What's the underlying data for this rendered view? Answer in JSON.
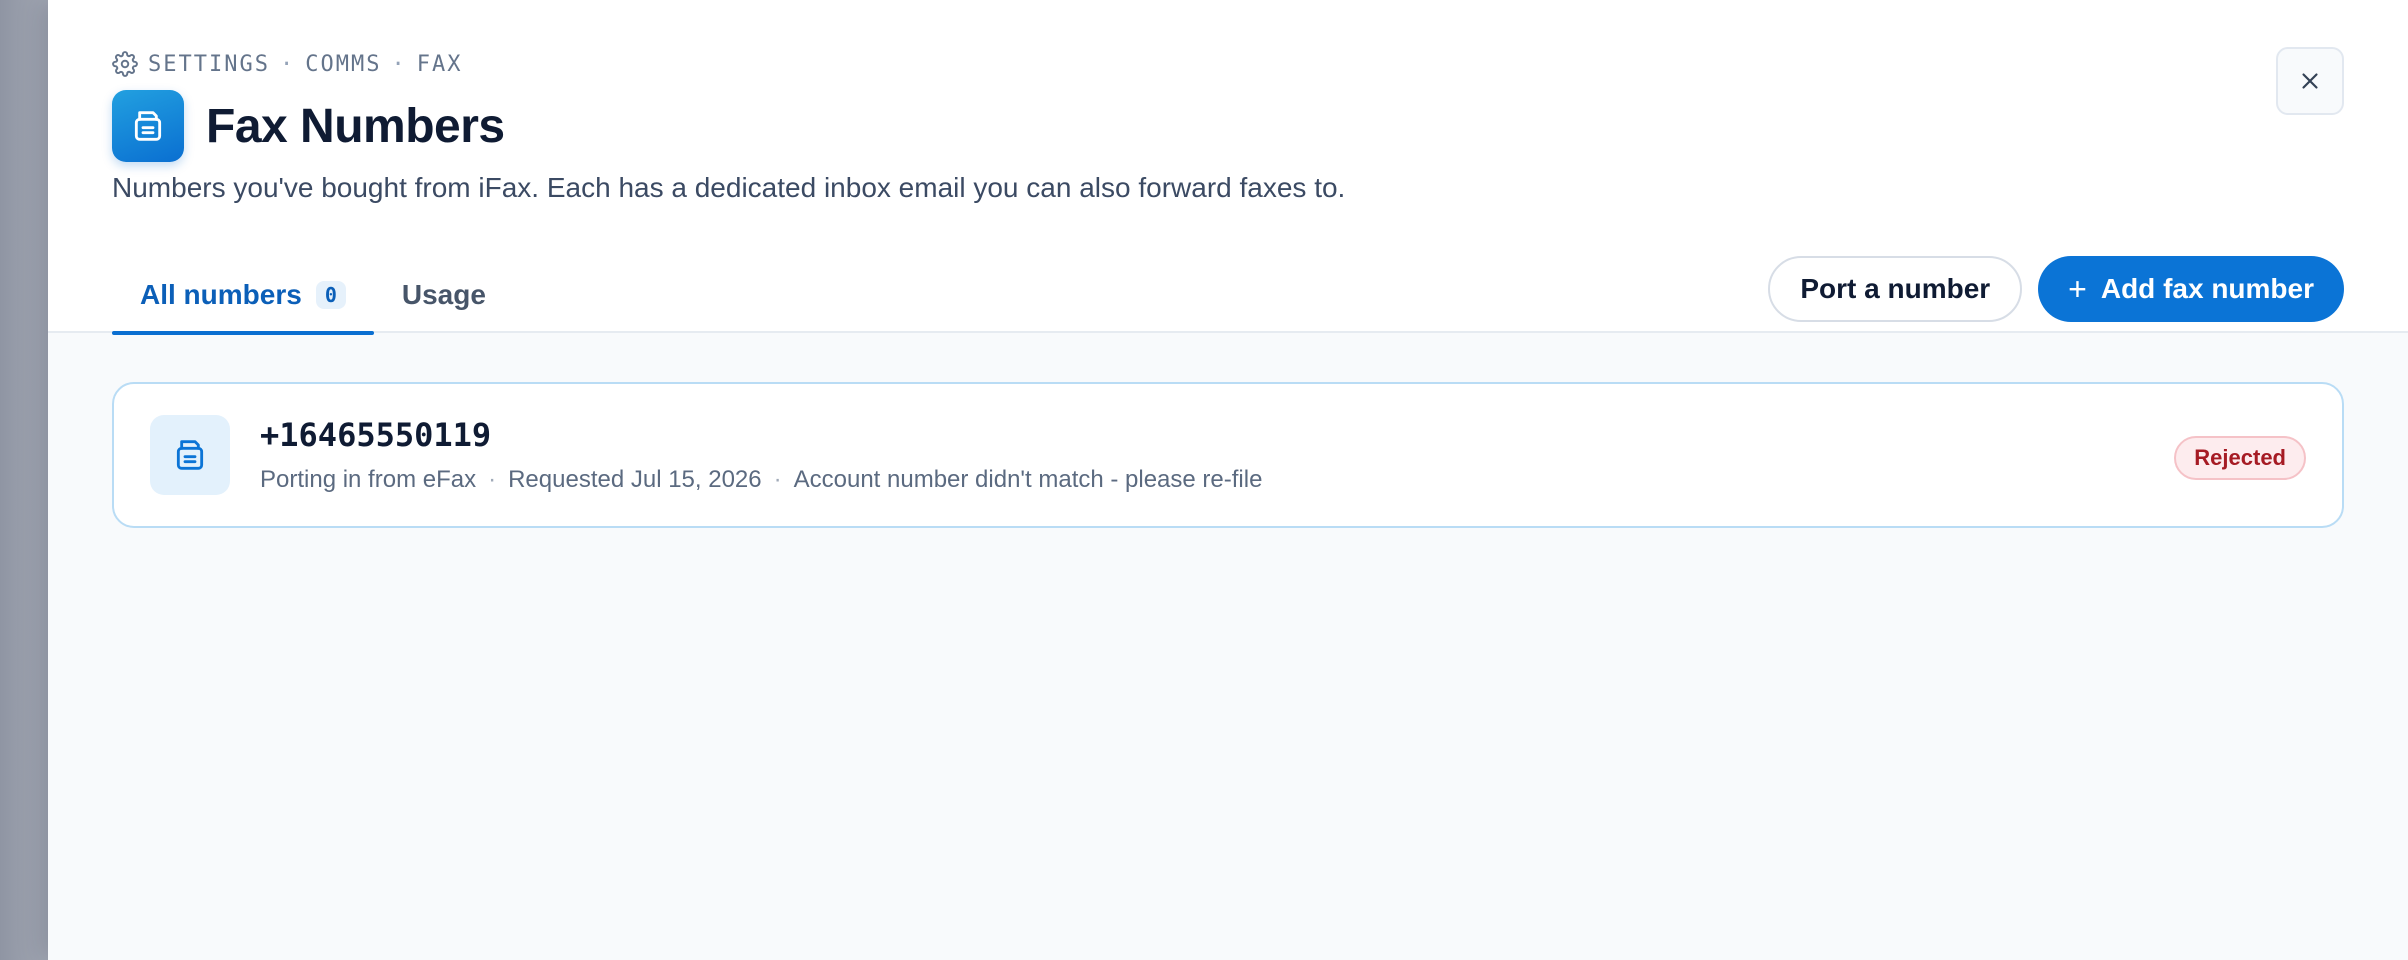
{
  "breadcrumb": {
    "items": [
      "SETTINGS",
      "COMMS",
      "FAX"
    ],
    "separator": "·"
  },
  "page": {
    "title": "Fax Numbers",
    "subtitle": "Numbers you've bought from iFax. Each has a dedicated inbox email you can also forward faxes to."
  },
  "tabs": [
    {
      "label": "All numbers",
      "count": "0",
      "active": true
    },
    {
      "label": "Usage",
      "active": false
    }
  ],
  "actions": {
    "port_label": "Port a number",
    "add_label": "Add fax number",
    "add_icon": "+"
  },
  "numbers": [
    {
      "number": "+16465550119",
      "meta": [
        "Porting in from eFax",
        "Requested Jul 15, 2026",
        "Account number didn't match - please re-file"
      ],
      "status": "Rejected"
    }
  ],
  "colors": {
    "accent": "#0b74d6",
    "rejected_text": "#a61b24",
    "rejected_bg": "#fdecee"
  }
}
